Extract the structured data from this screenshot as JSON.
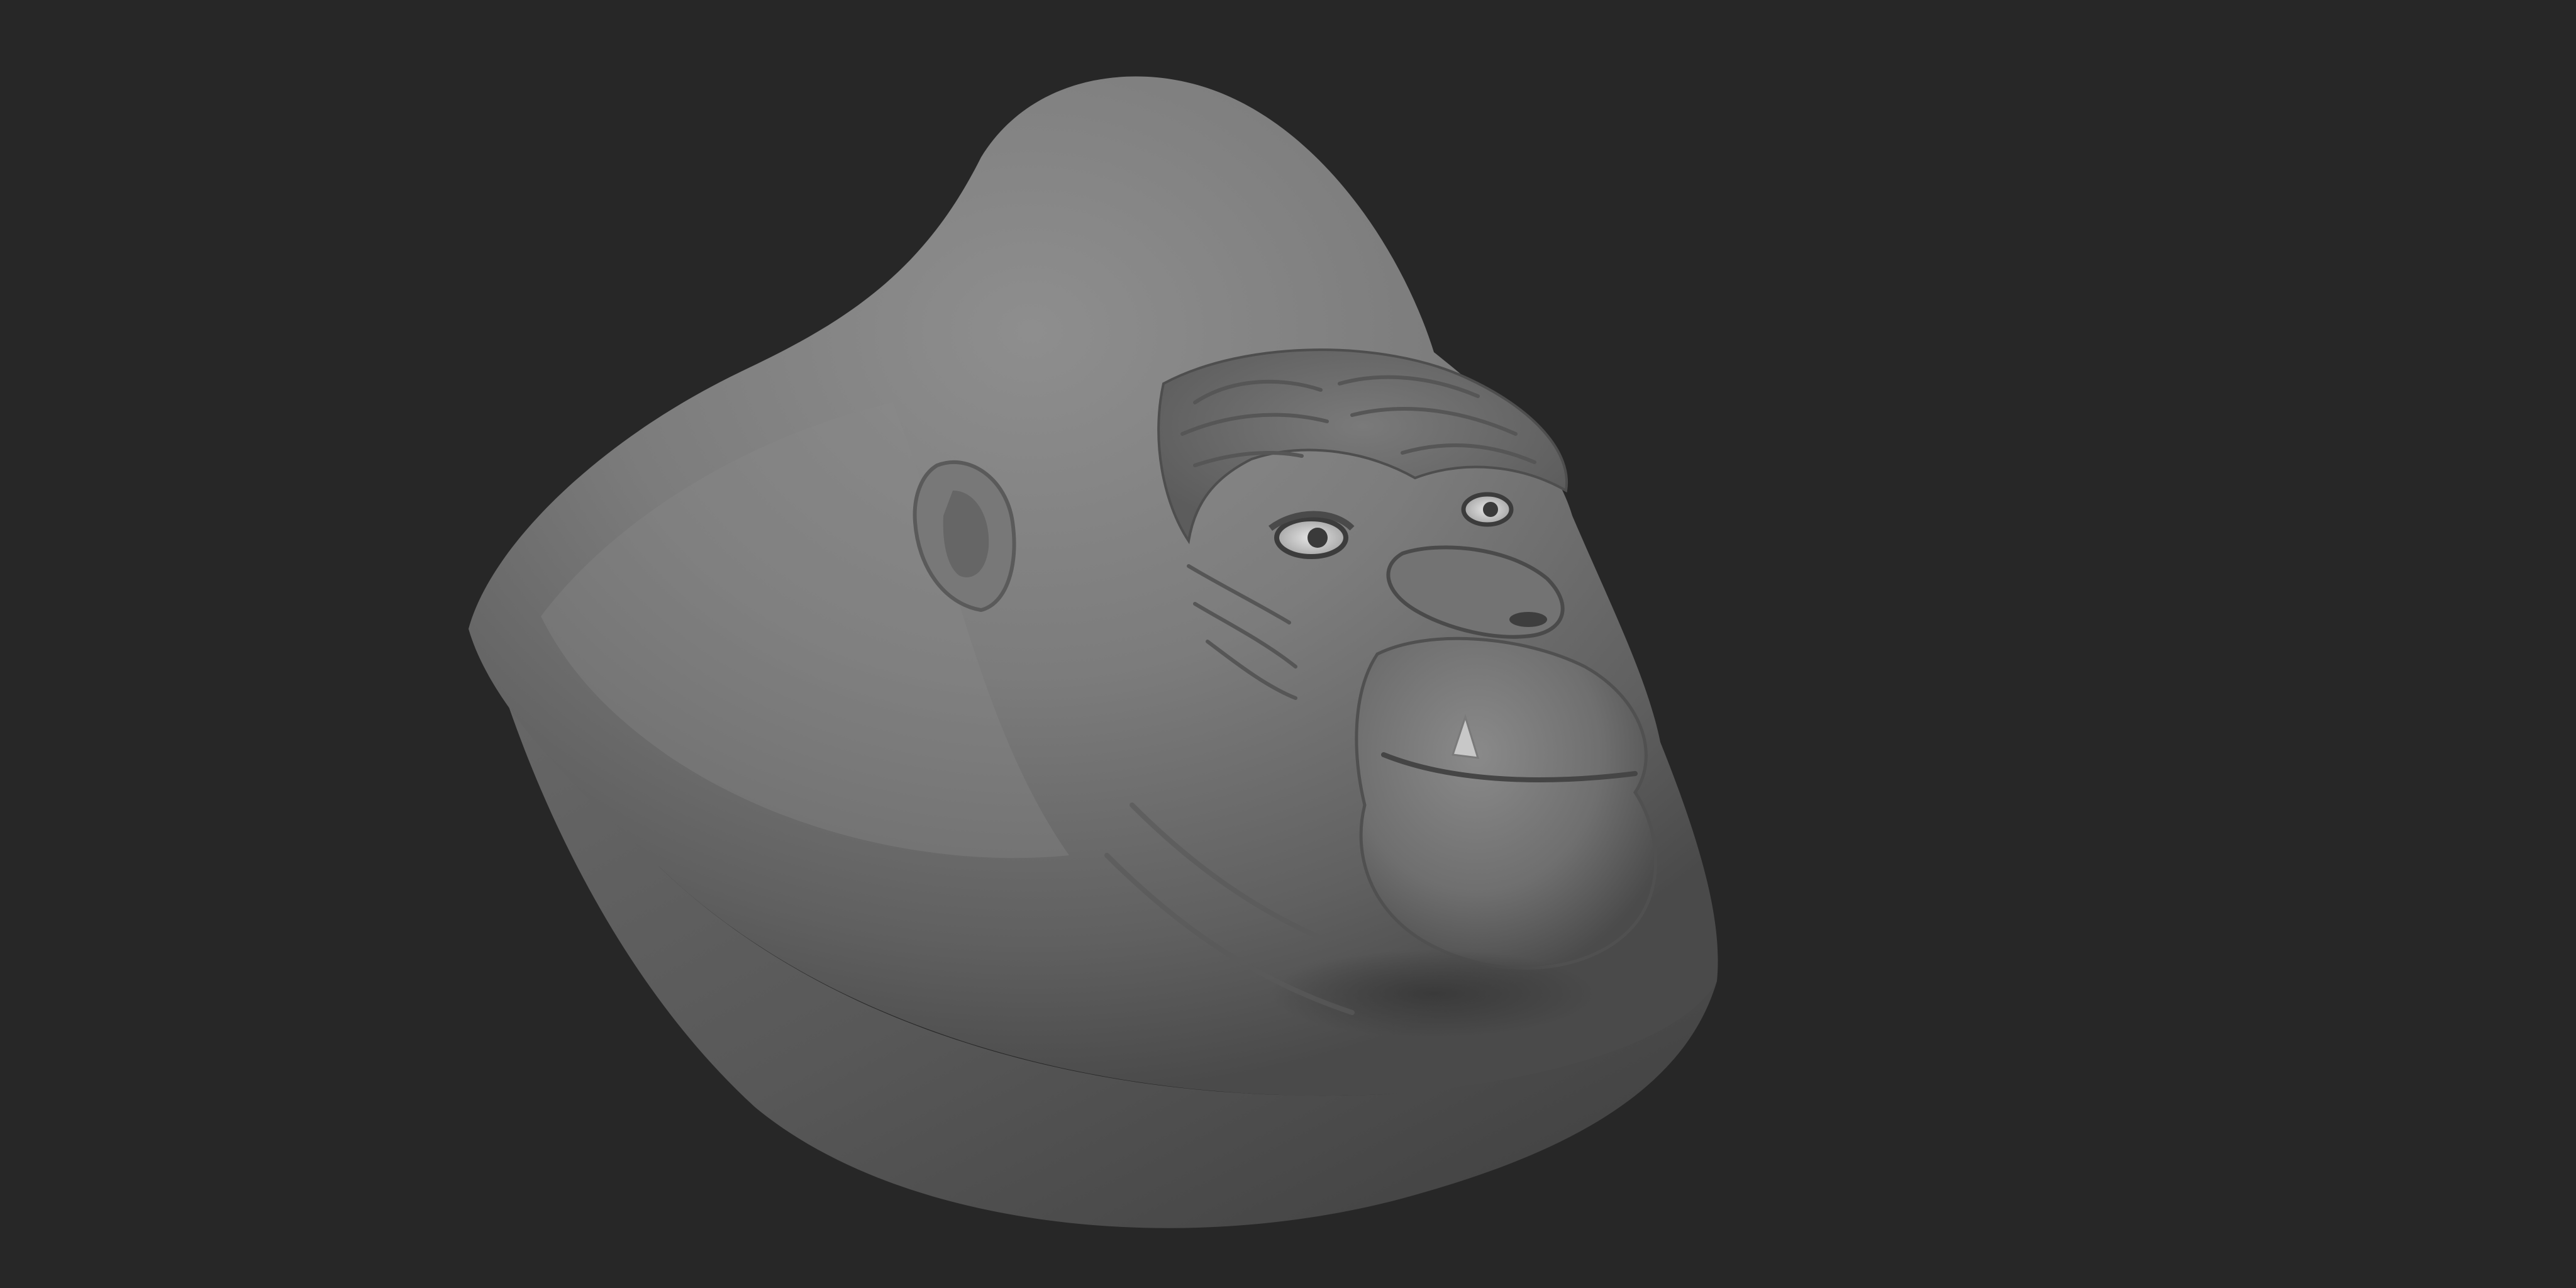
{
  "viewport": {
    "background_color": "#272727"
  },
  "model": {
    "subject": "gorilla-head-bust",
    "material_color": "#7a7a7a",
    "eye_color": "#d9d9d9"
  }
}
